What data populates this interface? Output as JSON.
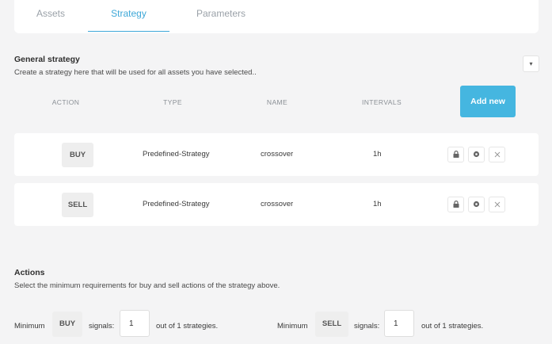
{
  "tabs": [
    {
      "label": "Assets"
    },
    {
      "label": "Strategy"
    },
    {
      "label": "Parameters"
    }
  ],
  "general": {
    "title": "General strategy",
    "description": "Create a strategy here that will be used for all assets you have selected..",
    "collapse_glyph": "▾"
  },
  "table": {
    "headers": {
      "action": "ACTION",
      "type": "TYPE",
      "name": "NAME",
      "intervals": "INTERVALS"
    },
    "add_new_label": "Add new",
    "rows": [
      {
        "action": "BUY",
        "type": "Predefined-Strategy",
        "name": "crossover",
        "interval": "1h"
      },
      {
        "action": "SELL",
        "type": "Predefined-Strategy",
        "name": "crossover",
        "interval": "1h"
      }
    ],
    "row_icons": [
      "lock-icon",
      "gear-icon",
      "close-icon"
    ]
  },
  "actions": {
    "title": "Actions",
    "description": "Select the minimum requirements for buy and sell actions of the strategy above.",
    "buy": {
      "prefix": "Minimum",
      "chip": "BUY",
      "signals_label": "signals:",
      "value": "1",
      "suffix": "out of 1 strategies."
    },
    "sell": {
      "prefix": "Minimum",
      "chip": "SELL",
      "signals_label": "signals:",
      "value": "1",
      "suffix": "out of 1 strategies."
    }
  },
  "colors": {
    "accent": "#45b6e0",
    "active_tab": "#3ea8d8",
    "background": "#f4f4f5"
  }
}
